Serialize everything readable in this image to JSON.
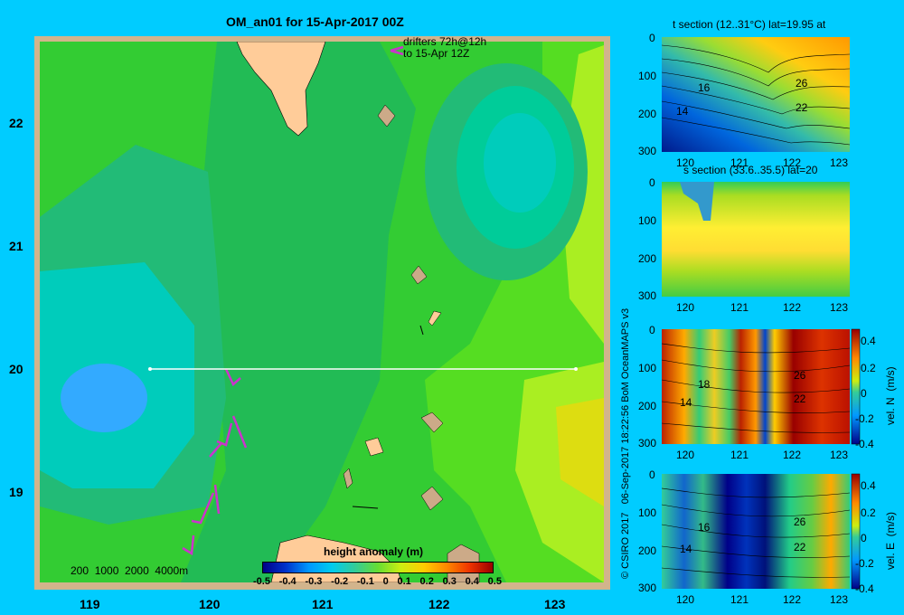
{
  "map": {
    "title": "OM_an01 for 15-Apr-2017 00Z",
    "drifters_line1": "drifters 72h@12h",
    "drifters_line2": "to 15-Apr 12Z",
    "depth_legend": "200  1000  2000  4000m",
    "x_ticks": [
      "119",
      "120",
      "121",
      "122",
      "123"
    ],
    "y_ticks": [
      "22",
      "21",
      "20",
      "19"
    ],
    "colorbar_title": "height anomaly (m)",
    "colorbar_ticks": [
      "-0.5",
      "-0.4",
      "-0.3",
      "-0.2",
      "-0.1",
      "0",
      "0.1",
      "0.2",
      "0.3",
      "0.4",
      "0.5"
    ],
    "section_line": {
      "lon_start": 119.5,
      "lon_end": 123.2,
      "lat": 20.0
    }
  },
  "copyright": "© CSIRO 2017   06-Sep-2017 18:22:56 BoM OceanMAPS v3",
  "panels": [
    {
      "title": "t section (12..31°C) lat=19.95 at",
      "x_ticks": [
        "120",
        "121",
        "122",
        "123"
      ],
      "y_ticks": [
        "0",
        "100",
        "200",
        "300"
      ],
      "contour_labels": [
        "16",
        "14",
        "26",
        "22"
      ],
      "has_colorbar": false
    },
    {
      "title": "s section (33.6..35.5) lat=20",
      "x_ticks": [
        "120",
        "121",
        "122",
        "123"
      ],
      "y_ticks": [
        "0",
        "100",
        "200",
        "300"
      ],
      "contour_labels": [],
      "has_colorbar": false
    },
    {
      "title": "",
      "x_ticks": [
        "120",
        "121",
        "122",
        "123"
      ],
      "y_ticks": [
        "0",
        "100",
        "200",
        "300"
      ],
      "contour_labels": [
        "18",
        "14",
        "26",
        "22"
      ],
      "has_colorbar": true,
      "cb_label": "vel. N  (m/s)",
      "cb_ticks": [
        "0.4",
        "0.2",
        "0",
        "-0.2",
        "-0.4"
      ]
    },
    {
      "title": "",
      "x_ticks": [
        "120",
        "121",
        "122",
        "123"
      ],
      "y_ticks": [
        "0",
        "100",
        "200",
        "300"
      ],
      "contour_labels": [
        "16",
        "14",
        "26",
        "22"
      ],
      "has_colorbar": true,
      "cb_label": "vel. E  (m/s)",
      "cb_ticks": [
        "0.4",
        "0.2",
        "0",
        "-0.2",
        "-0.4"
      ]
    }
  ],
  "chart_data": [
    {
      "type": "heatmap",
      "title": "OM_an01 for 15-Apr-2017 00Z",
      "xlabel": "",
      "ylabel": "",
      "xlim": [
        118.5,
        123.5
      ],
      "ylim": [
        18.3,
        22.7
      ],
      "colorbar": "height anomaly (m)",
      "clim": [
        -0.5,
        0.5
      ],
      "features": [
        {
          "lon": 119.6,
          "lat": 19.9,
          "value": -0.25
        },
        {
          "lon": 122.4,
          "lat": 21.7,
          "value": -0.15
        },
        {
          "lon": 123.3,
          "lat": 19.5,
          "value": 0.15
        }
      ]
    },
    {
      "type": "heatmap",
      "title": "t section (12..31°C) lat=19.95 at",
      "xlim": [
        119.6,
        123.2
      ],
      "ylim": [
        300,
        0
      ],
      "range": [
        12,
        31
      ]
    },
    {
      "type": "heatmap",
      "title": "s section (33.6..35.5) lat=20",
      "xlim": [
        119.6,
        123.2
      ],
      "ylim": [
        300,
        0
      ],
      "range": [
        33.6,
        35.5
      ]
    },
    {
      "type": "heatmap",
      "title": "",
      "colorbar": "vel. N  (m/s)",
      "xlim": [
        119.6,
        123.2
      ],
      "ylim": [
        300,
        0
      ],
      "clim": [
        -0.4,
        0.4
      ]
    },
    {
      "type": "heatmap",
      "title": "",
      "colorbar": "vel. E  (m/s)",
      "xlim": [
        119.6,
        123.2
      ],
      "ylim": [
        300,
        0
      ],
      "clim": [
        -0.4,
        0.4
      ]
    }
  ]
}
